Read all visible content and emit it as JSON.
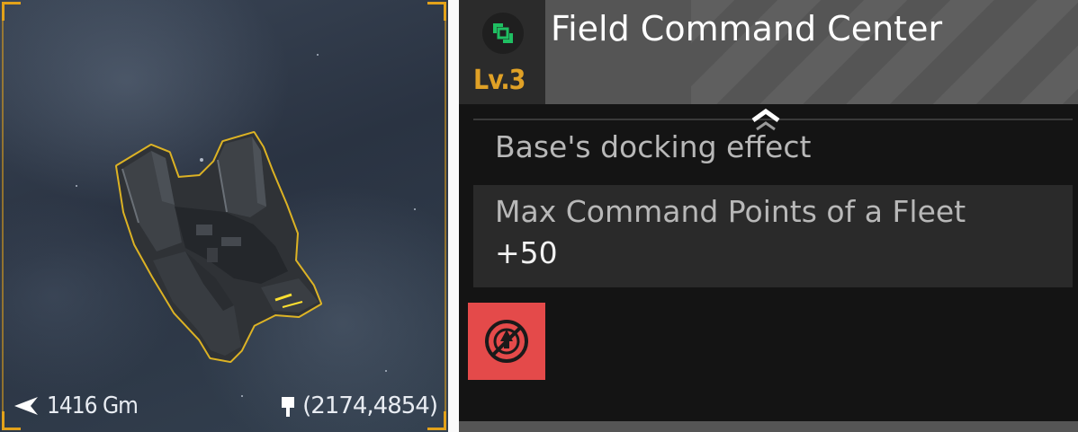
{
  "space_view": {
    "distance": "1416 Gm",
    "coordinates": "(2174,4854)",
    "distance_icon": "direction-arrow-icon",
    "coordinates_icon": "location-flag-icon",
    "frame_color": "#e3a21a"
  },
  "structure": {
    "name": "Field Command Center",
    "level": "Lv.3",
    "type_icon": "rotate-square-icon",
    "type_icon_color": "#1fbf62",
    "level_color": "#e0a126"
  },
  "docking": {
    "section_label": "Base's docking effect",
    "collapse_icon": "chevron-up-icon",
    "stats": [
      {
        "name": "Max Command Points of a Fleet",
        "value": "+50"
      }
    ]
  },
  "actions": {
    "button_icon": "no-docking-icon",
    "button_color": "#e44a4a"
  }
}
